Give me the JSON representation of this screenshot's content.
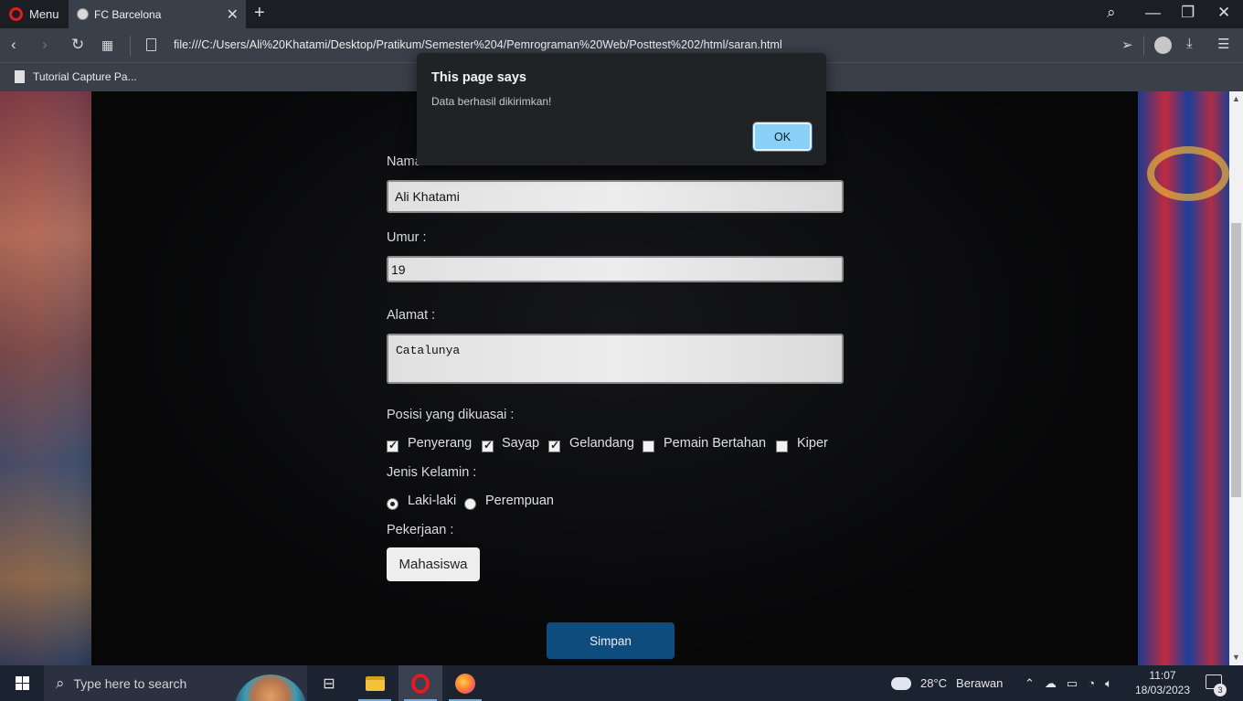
{
  "browser": {
    "menu_label": "Menu",
    "tab_title": "FC Barcelona",
    "url": "file:///C:/Users/Ali%20Khatami/Desktop/Pratikum/Semester%204/Pemrograman%20Web/Posttest%202/html/saran.html",
    "bookmark": "Tutorial Capture Pa..."
  },
  "form": {
    "nama_label": "Nama :",
    "nama_value": "Ali Khatami",
    "umur_label": "Umur :",
    "umur_value": "19",
    "alamat_label": "Alamat :",
    "alamat_value": "Catalunya",
    "posisi_label": "Posisi yang dikuasai :",
    "posisi_options": [
      {
        "label": "Penyerang",
        "checked": true
      },
      {
        "label": "Sayap",
        "checked": true
      },
      {
        "label": "Gelandang",
        "checked": true
      },
      {
        "label": "Pemain Bertahan",
        "checked": false
      },
      {
        "label": "Kiper",
        "checked": false
      }
    ],
    "kelamin_label": "Jenis Kelamin :",
    "kelamin_options": [
      {
        "label": "Laki-laki",
        "selected": true
      },
      {
        "label": "Perempuan",
        "selected": false
      }
    ],
    "pekerjaan_label": "Pekerjaan :",
    "pekerjaan_value": "Mahasiswa",
    "submit_label": "Simpan"
  },
  "dialog": {
    "title": "This page says",
    "message": "Data berhasil dikirimkan!",
    "ok_label": "OK"
  },
  "taskbar": {
    "search_placeholder": "Type here to search",
    "weather_temp": "28°C",
    "weather_desc": "Berawan",
    "time": "11:07",
    "date": "18/03/2023",
    "notification_count": "3"
  }
}
